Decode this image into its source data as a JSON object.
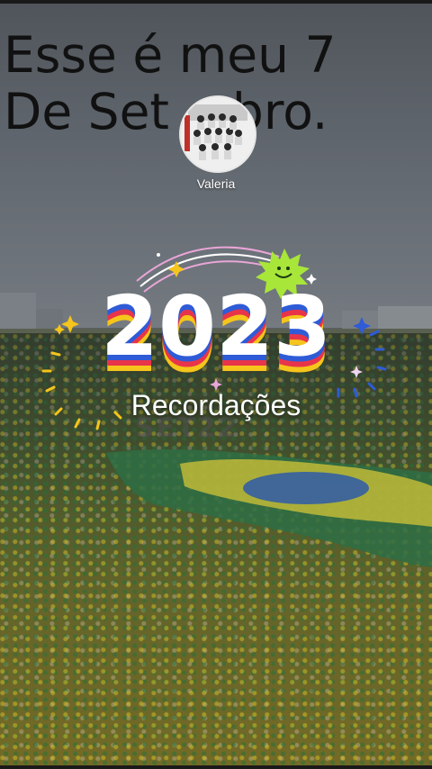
{
  "overlay_text": {
    "line1": "Esse é meu 7",
    "line2": "De Set    bro."
  },
  "profile": {
    "username": "Valeria",
    "avatar_icon": "group-photo-avatar"
  },
  "sticker": {
    "year": "2023",
    "subtitle": "Recordações",
    "background_watermark": "SET22",
    "colors": {
      "red": "#e8344a",
      "blue": "#2f5bd6",
      "yellow": "#f5c51b",
      "green_smiley": "#a8e63a"
    }
  },
  "background": {
    "scene": "crowd-with-flag",
    "flag_colors": {
      "green": "#2e7d4a",
      "yellow": "#d7c93a",
      "blue": "#2d5aa8"
    }
  }
}
